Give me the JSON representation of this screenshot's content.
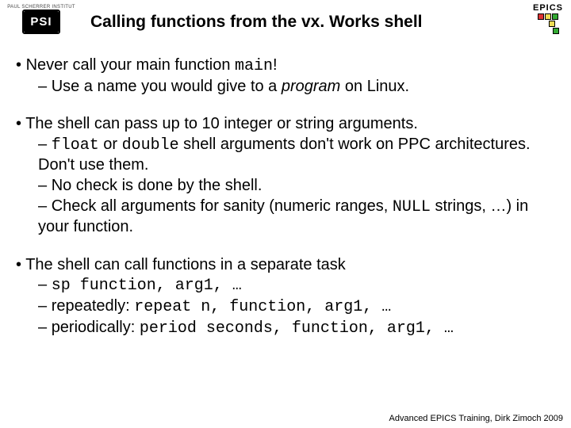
{
  "header": {
    "psi_top": "PAUL SCHERRER INSTITUT",
    "psi_mark": "PSI",
    "title": "Calling functions from the vx. Works shell",
    "epics_label": "EPICS"
  },
  "bullets": {
    "b1_pre": "Never call your main function ",
    "b1_code": "main",
    "b1_post": "!",
    "b1s1_pre": "Use a name you would give to a ",
    "b1s1_em": "program",
    "b1s1_post": " on Linux.",
    "b2": "The shell can pass up to 10 integer or string arguments.",
    "b2s1_code1": "float",
    "b2s1_mid": " or ",
    "b2s1_code2": "double",
    "b2s1_post": " shell arguments don't work on PPC architectures. Don't use them.",
    "b2s2": "No check is done by the shell.",
    "b2s3_pre": "Check all arguments for sanity (numeric ranges, ",
    "b2s3_code": "NULL",
    "b2s3_post": " strings, …) in your function.",
    "b3": "The shell can call functions in a separate task",
    "b3s1_code": "sp function, arg1, …",
    "b3s2_pre": "repeatedly: ",
    "b3s2_code": "repeat n, function, arg1, …",
    "b3s3_pre": "periodically: ",
    "b3s3_code": "period seconds, function, arg1, …"
  },
  "footer": "Advanced EPICS Training, Dirk Zimoch 2009"
}
